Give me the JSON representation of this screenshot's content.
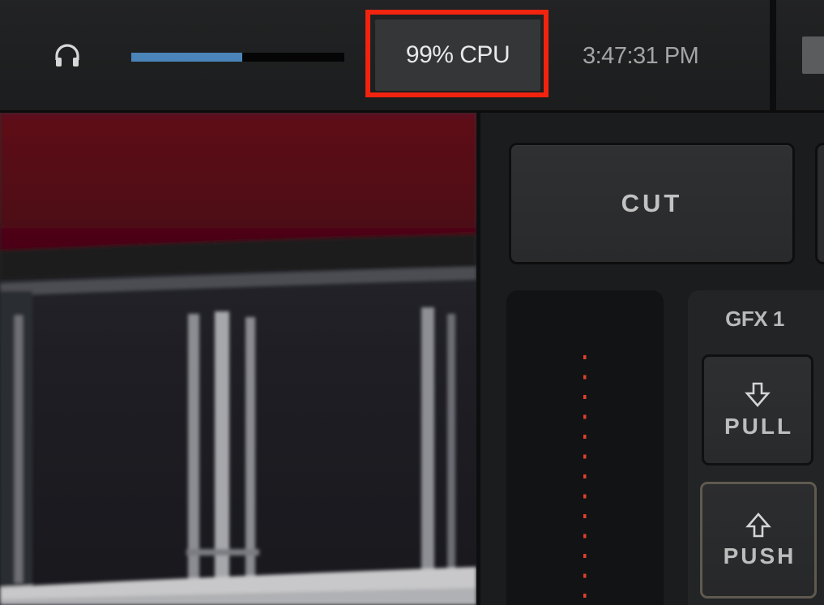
{
  "topbar": {
    "audio_level": 0.52,
    "cpu_text": "99% CPU",
    "clock": "3:47:31 PM"
  },
  "switcher": {
    "cut_label": "CUT",
    "gfx": {
      "title": "GFX 1",
      "pull_label": "PULL",
      "push_label": "PUSH"
    }
  },
  "icons": {
    "headphones": "headphones-icon",
    "pull_arrow": "arrow-down-icon",
    "push_arrow": "arrow-up-icon"
  },
  "colors": {
    "highlight": "#f0240f",
    "meter_fill": "#4a84b8",
    "tbar_marker": "#e0402c",
    "push_border": "#5f5a4f"
  }
}
